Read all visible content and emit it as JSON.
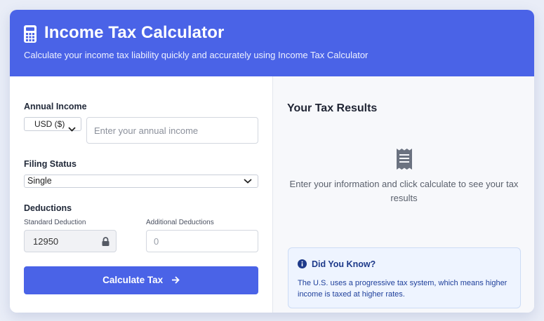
{
  "header": {
    "title": "Income Tax Calculator",
    "subtitle": "Calculate your income tax liability quickly and accurately using Income Tax Calculator",
    "icon": "calculator-icon"
  },
  "form": {
    "annual_income_label": "Annual Income",
    "currency_selected": "USD ($)",
    "income_placeholder": "Enter your annual income",
    "filing_status_label": "Filing Status",
    "filing_status_selected": "Single",
    "deductions_label": "Deductions",
    "standard_deduction_label": "Standard Deduction",
    "standard_deduction_value": "12950",
    "additional_deductions_label": "Additional Deductions",
    "additional_deductions_placeholder": "0",
    "calculate_button": "Calculate Tax"
  },
  "results": {
    "title": "Your Tax Results",
    "empty_message": "Enter your information and click calculate to see your tax results",
    "icon": "receipt-icon"
  },
  "did_you_know": {
    "title": "Did You Know?",
    "text": "The U.S. uses a progressive tax system, which means higher income is taxed at higher rates."
  },
  "colors": {
    "primary": "#4a63e7",
    "info_bg": "#eef4ff",
    "info_text": "#1e3a8a"
  }
}
